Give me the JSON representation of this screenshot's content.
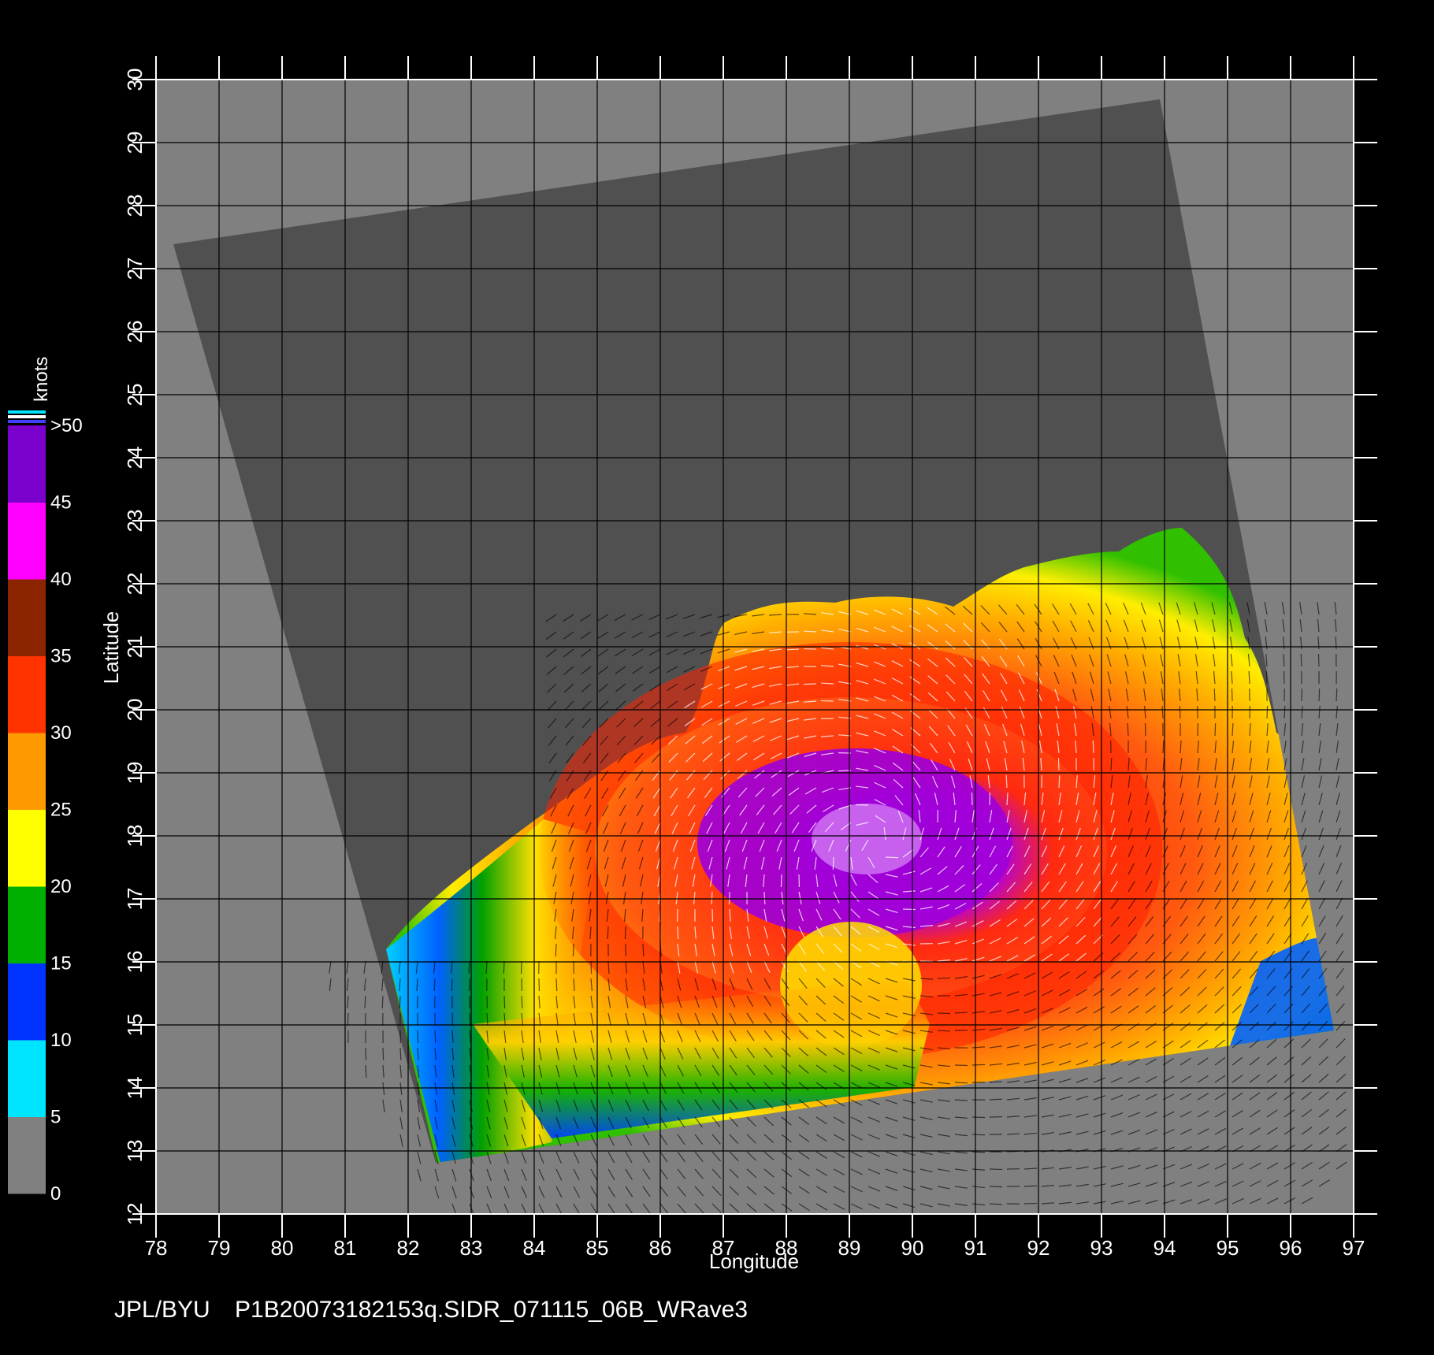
{
  "axes": {
    "xlabel": "Longitude",
    "ylabel": "Latitude",
    "lon_ticks": [
      "78",
      "79",
      "80",
      "81",
      "82",
      "83",
      "84",
      "85",
      "86",
      "87",
      "88",
      "89",
      "90",
      "91",
      "92",
      "93",
      "94",
      "95",
      "96",
      "97"
    ],
    "lat_ticks": [
      "12",
      "13",
      "14",
      "15",
      "16",
      "17",
      "18",
      "19",
      "20",
      "21",
      "22",
      "23",
      "24",
      "25",
      "26",
      "27",
      "28",
      "29",
      "30"
    ]
  },
  "colorbar": {
    "unit": "knots",
    "labels": [
      "0",
      "5",
      "10",
      "15",
      "20",
      "25",
      "30",
      "35",
      "40",
      "45",
      ">50"
    ],
    "colors": [
      "#808080",
      "#00e5ff",
      "#0033ff",
      "#00b000",
      "#ffff00",
      "#ff9900",
      "#ff3300",
      "#8b2500",
      "#ff00ff",
      "#7a00cc"
    ]
  },
  "map": {
    "background_color": "#808080",
    "swath_color": "#505050",
    "storm_center_lon": 89.5,
    "storm_center_lat": 17.9
  },
  "footer": {
    "credit": "JPL/BYU",
    "product": "P1B20073182153q.SIDR_071115_06B_WRave3"
  }
}
